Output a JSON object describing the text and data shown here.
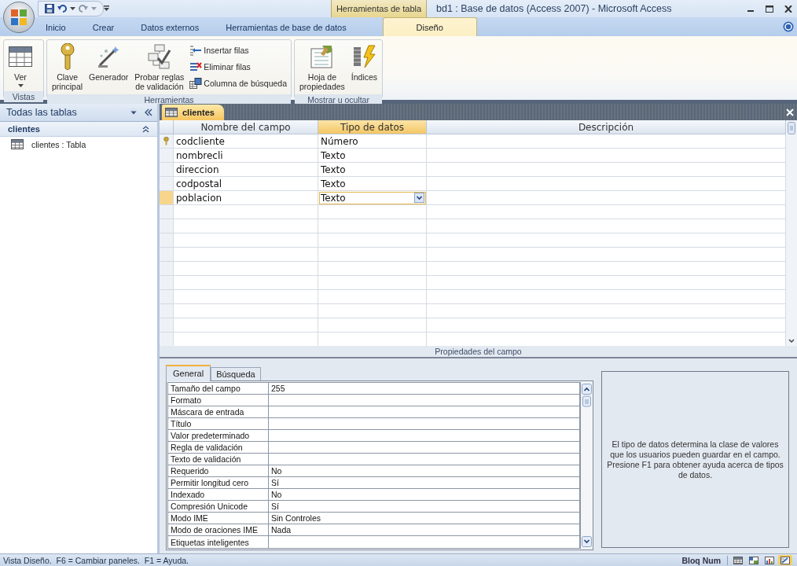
{
  "window": {
    "title": "bd1 : Base de datos (Access 2007) - Microsoft Access",
    "contextual_tab": "Herramientas de tabla"
  },
  "ribbon_tabs": [
    {
      "label": "Inicio",
      "selected": false
    },
    {
      "label": "Crear",
      "selected": false
    },
    {
      "label": "Datos externos",
      "selected": false
    },
    {
      "label": "Herramientas de base de datos",
      "selected": false
    },
    {
      "label": "Diseño",
      "selected": true
    }
  ],
  "ribbon_groups": [
    {
      "label": "Vistas",
      "buttons": [
        {
          "label": "Ver",
          "kind": "large",
          "dropdown": true
        }
      ]
    },
    {
      "label": "Herramientas",
      "buttons": [
        {
          "label": "Clave\nprincipal",
          "kind": "large",
          "dropdown": false
        },
        {
          "label": "Generador",
          "kind": "large",
          "dropdown": false
        },
        {
          "label": "Probar reglas\nde validación",
          "kind": "large",
          "dropdown": false
        },
        {
          "label": "Insertar filas",
          "kind": "small",
          "dropdown": false
        },
        {
          "label": "Eliminar filas",
          "kind": "small",
          "dropdown": false
        },
        {
          "label": "Columna de búsqueda",
          "kind": "small",
          "dropdown": false
        }
      ]
    },
    {
      "label": "Mostrar u ocultar",
      "buttons": [
        {
          "label": "Hoja de\npropiedades",
          "kind": "large",
          "dropdown": false
        },
        {
          "label": "Índices",
          "kind": "large",
          "dropdown": false
        }
      ]
    }
  ],
  "nav_pane": {
    "title": "Todas las tablas",
    "groups": [
      {
        "label": "clientes",
        "expanded": true,
        "items": [
          {
            "label": "clientes : Tabla"
          }
        ]
      }
    ]
  },
  "document": {
    "tab": "clientes",
    "columns": [
      {
        "label": "Nombre del campo",
        "selected": false
      },
      {
        "label": "Tipo de datos",
        "selected": true
      },
      {
        "label": "Descripción",
        "selected": false
      }
    ],
    "rows": [
      {
        "name": "codcliente",
        "type": "Número",
        "primary_key": true,
        "selected": false
      },
      {
        "name": "nombrecli",
        "type": "Texto",
        "primary_key": false,
        "selected": false
      },
      {
        "name": "direccion",
        "type": "Texto",
        "primary_key": false,
        "selected": false
      },
      {
        "name": "codpostal",
        "type": "Texto",
        "primary_key": false,
        "selected": false
      },
      {
        "name": "poblacion",
        "type": "Texto",
        "primary_key": false,
        "selected": true
      }
    ]
  },
  "field_properties": {
    "title": "Propiedades del campo",
    "tabs": [
      {
        "label": "General",
        "selected": true
      },
      {
        "label": "Búsqueda",
        "selected": false
      }
    ],
    "properties": [
      {
        "name": "Tamaño del campo",
        "value": "255"
      },
      {
        "name": "Formato"
      },
      {
        "name": "Máscara de entrada"
      },
      {
        "name": "Título"
      },
      {
        "name": "Valor predeterminado"
      },
      {
        "name": "Regla de validación"
      },
      {
        "name": "Texto de validación"
      },
      {
        "name": "Requerido",
        "value": "No"
      },
      {
        "name": "Permitir longitud cero",
        "value": "Sí"
      },
      {
        "name": "Indexado",
        "value": "No"
      },
      {
        "name": "Compresión Unicode",
        "value": "Sí"
      },
      {
        "name": "Modo IME",
        "value": "Sin Controles"
      },
      {
        "name": "Modo de oraciones IME",
        "value": "Nada"
      },
      {
        "name": "Etiquetas inteligentes"
      }
    ],
    "help": "El tipo de datos determina la clase de valores que los usuarios pueden guardar en el campo. Presione F1 para obtener ayuda acerca de tipos de datos."
  },
  "status_bar": {
    "text": "Vista Diseño.  F6 = Cambiar paneles.  F1 = Ayuda.",
    "indicator": "Bloq Num",
    "view_buttons": [
      {
        "selected": false
      },
      {
        "selected": false
      },
      {
        "selected": false
      },
      {
        "selected": true
      }
    ]
  }
}
